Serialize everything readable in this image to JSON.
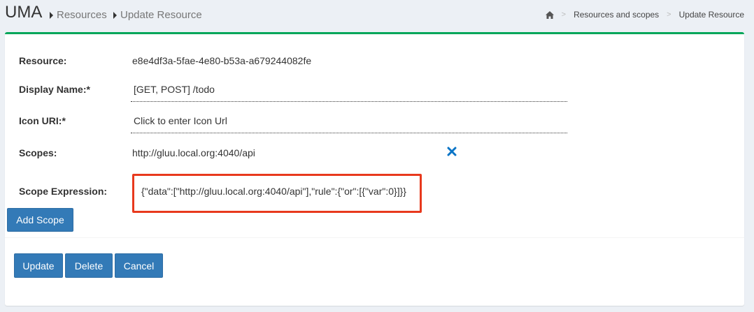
{
  "header": {
    "title": "UMA",
    "crumbs": [
      "Resources",
      "Update Resource"
    ],
    "breadcrumb": [
      "Resources and scopes",
      "Update Resource"
    ],
    "sep": ">"
  },
  "form": {
    "resource_label": "Resource:",
    "resource_value": "e8e4df3a-5fae-4e80-b53a-a679244082fe",
    "display_name_label": "Display Name:*",
    "display_name_value": "[GET, POST] /todo",
    "icon_uri_label": "Icon URI:*",
    "icon_uri_placeholder": "Click to enter Icon Url",
    "scopes_label": "Scopes:",
    "scopes_value": "http://gluu.local.org:4040/api",
    "scope_expression_label": "Scope Expression:",
    "scope_expression_value": "{\"data\":[\"http://gluu.local.org:4040/api\"],\"rule\":{\"or\":[{\"var\":0}]}}",
    "add_scope": "Add Scope"
  },
  "actions": {
    "update": "Update",
    "delete": "Delete",
    "cancel": "Cancel"
  },
  "colors": {
    "accent": "#00a65a",
    "button": "#337ab7",
    "highlight": "#e8391d",
    "remove_icon": "#0a74c6"
  },
  "icons": [
    "home-icon",
    "remove-icon",
    "caret-right-icon"
  ]
}
